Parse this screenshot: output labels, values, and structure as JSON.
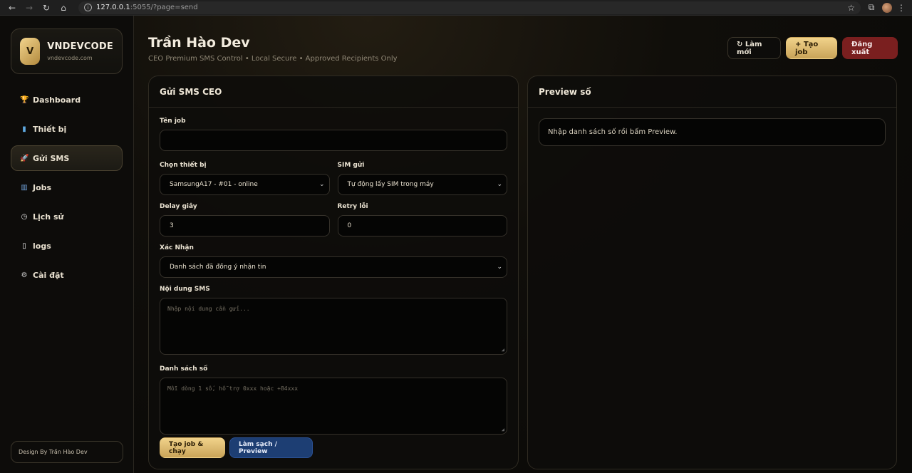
{
  "browser": {
    "url_host": "127.0.0.1",
    "url_rest": ":5055/?page=send"
  },
  "sidebar": {
    "brand_logo": "V",
    "brand_name": "VNDEVCODE",
    "brand_sub": "vndevcode.com",
    "items": [
      {
        "label": "Dashboard",
        "icon": "trophy-icon",
        "glyph": "🏆"
      },
      {
        "label": "Thiết bị",
        "icon": "phone-icon",
        "glyph": "▮"
      },
      {
        "label": "Gửi SMS",
        "icon": "rocket-icon",
        "glyph": "🚀"
      },
      {
        "label": "Jobs",
        "icon": "chart-icon",
        "glyph": "▥"
      },
      {
        "label": "Lịch sử",
        "icon": "clock-icon",
        "glyph": "◷"
      },
      {
        "label": "logs",
        "icon": "document-icon",
        "glyph": "▯"
      },
      {
        "label": "Cài đặt",
        "icon": "gear-icon",
        "glyph": "⚙"
      }
    ],
    "active_index": 2,
    "credit": "Design By Trần Hào Dev"
  },
  "header": {
    "title": "Trần Hào Dev",
    "subtitle": "CEO Premium SMS Control • Local Secure • Approved Recipients Only",
    "refresh_label": "↻ Làm mới",
    "new_job_label": "+ Tạo job",
    "logout_label": "Đăng xuất"
  },
  "send_panel": {
    "title": "Gửi SMS CEO",
    "job_name_label": "Tên job",
    "job_name_value": "",
    "device_label": "Chọn thiết bị",
    "device_value": "SamsungA17 - #01 - online",
    "sim_label": "SIM gửi",
    "sim_value": "Tự động lấy SIM trong máy",
    "delay_label": "Delay giây",
    "delay_value": "3",
    "retry_label": "Retry lỗi",
    "retry_value": "0",
    "confirm_label": "Xác Nhận",
    "confirm_value": "Danh sách đã đồng ý nhận tin",
    "content_label": "Nội dung SMS",
    "content_placeholder": "Nhập nội dung cần gửi...",
    "numbers_label": "Danh sách số",
    "numbers_placeholder": "Mỗi dòng 1 số, hỗ trợ 0xxx hoặc +84xxx",
    "run_label": "Tạo job & chạy",
    "clean_label": "Làm sạch / Preview"
  },
  "preview_panel": {
    "title": "Preview số",
    "message": "Nhập danh sách số rồi bấm Preview."
  }
}
